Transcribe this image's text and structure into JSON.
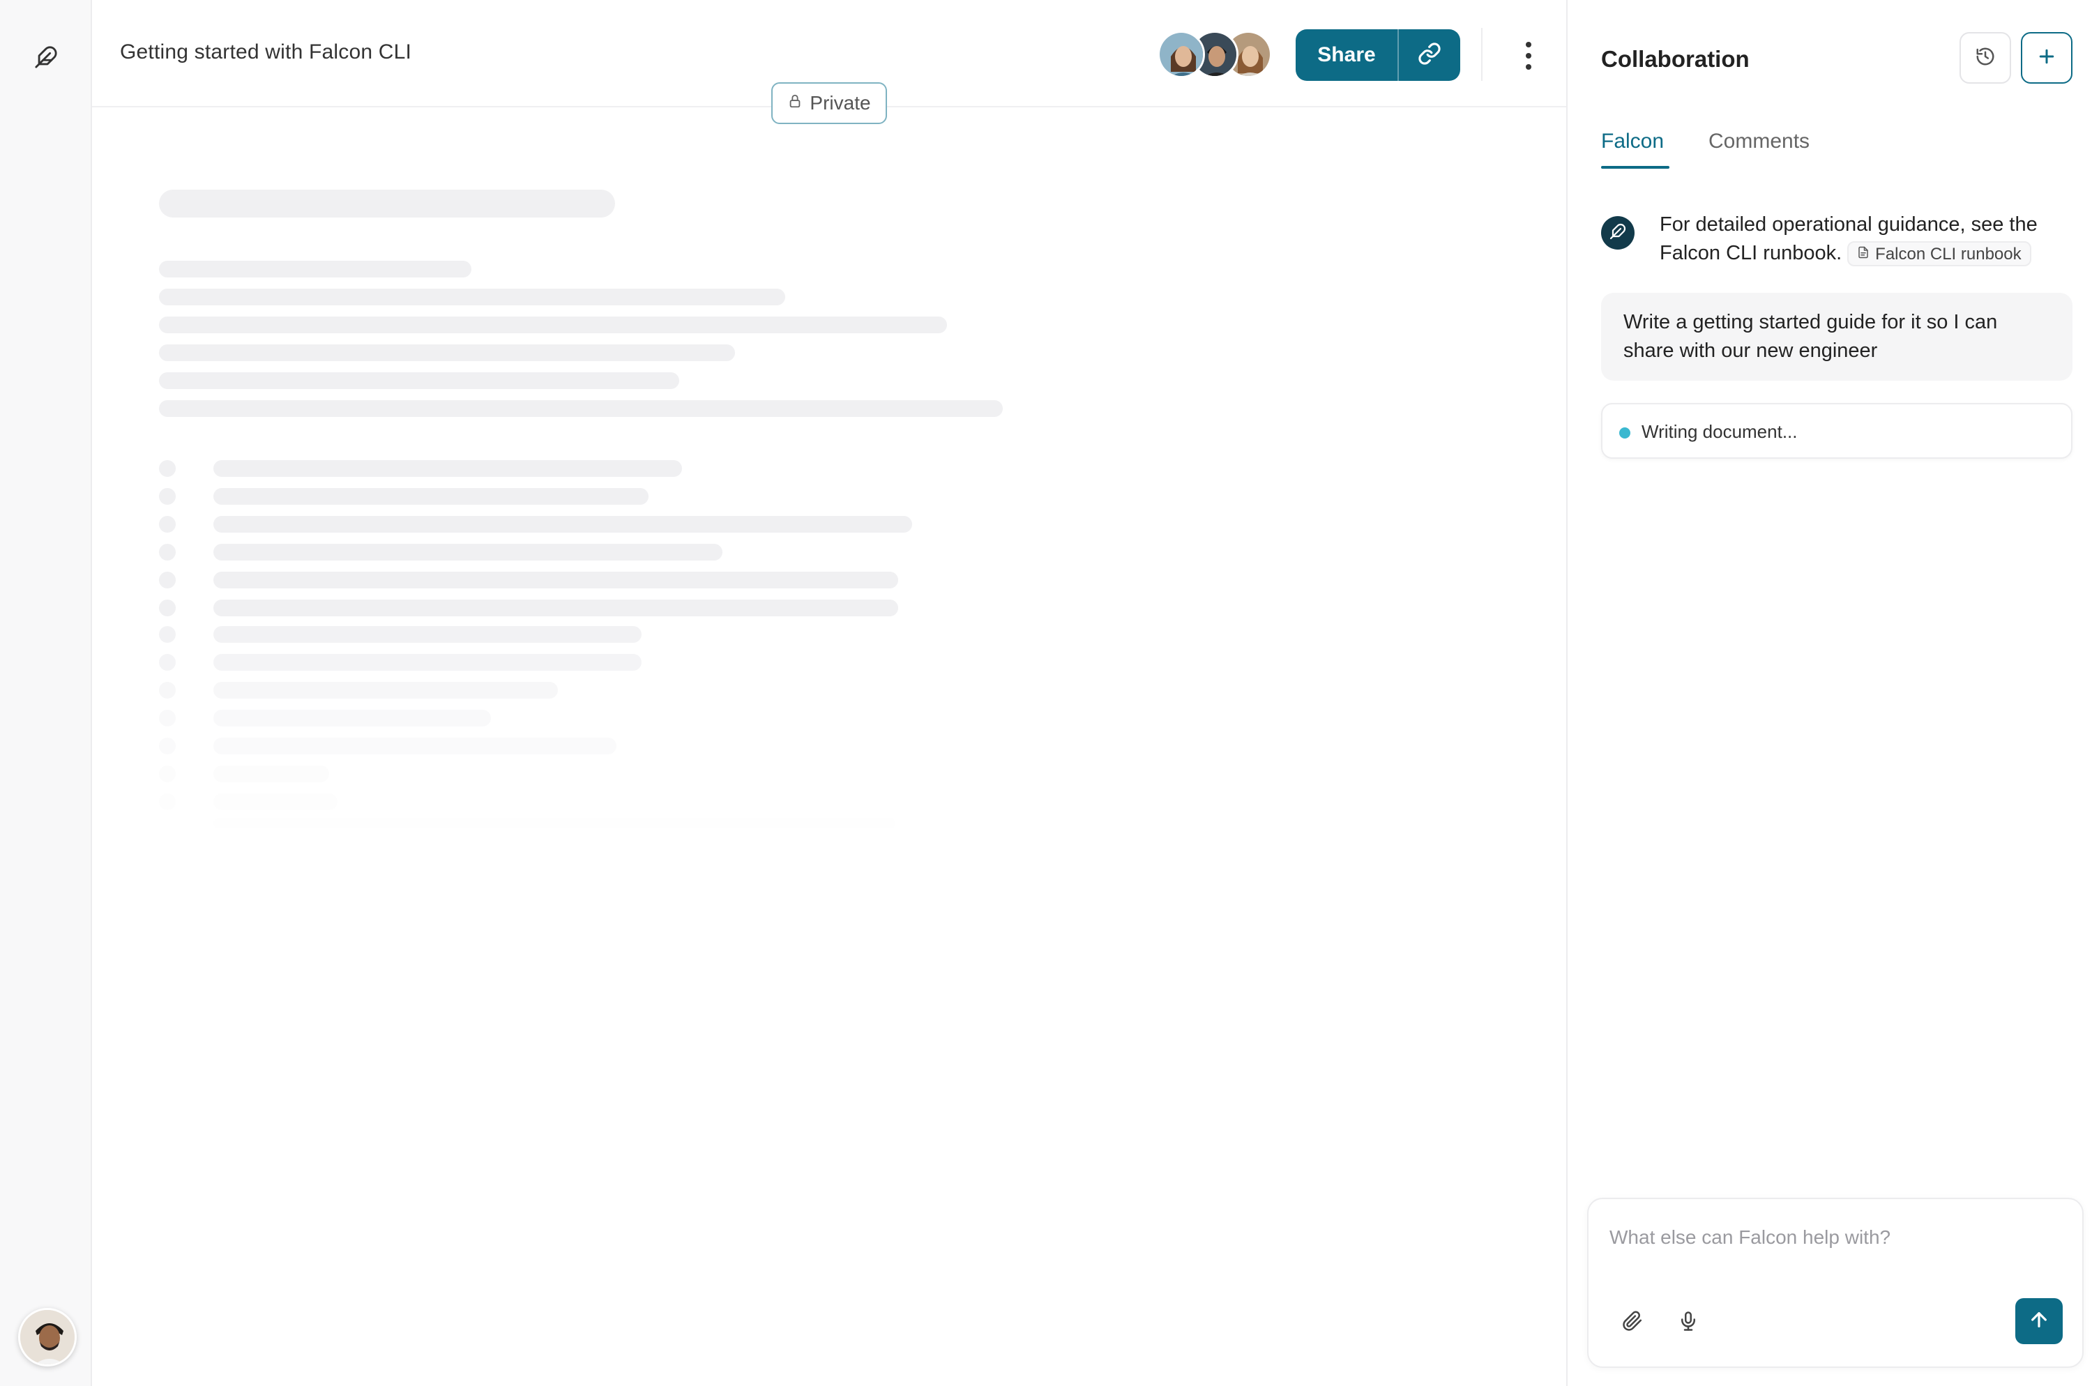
{
  "document": {
    "title": "Getting started with Falcon CLI",
    "visibility_label": "Private"
  },
  "header": {
    "share_label": "Share",
    "collaborators": [
      "collaborator-1",
      "collaborator-2",
      "collaborator-3"
    ]
  },
  "panel": {
    "title": "Collaboration",
    "tabs": [
      {
        "label": "Falcon",
        "active": true
      },
      {
        "label": "Comments",
        "active": false
      }
    ],
    "messages": {
      "assistant": {
        "text": "For detailed operational guidance, see the Falcon CLI runbook.",
        "reference_label": "Falcon CLI runbook"
      },
      "user": {
        "text": "Write a getting started guide for it so I can share with our new engineer"
      }
    },
    "status": {
      "text": "Writing document..."
    },
    "composer": {
      "placeholder": "What else can Falcon help with?"
    }
  },
  "colors": {
    "accent": "#0d6b86",
    "status_dot": "#3ab8d0",
    "skeleton": "#f0f0f2"
  },
  "icons": {
    "app_logo": "feather-icon",
    "history": "history-icon",
    "new": "plus-icon",
    "link": "link-icon",
    "more": "more-vertical-icon",
    "lock": "lock-icon",
    "attach": "paperclip-icon",
    "mic": "microphone-icon",
    "send": "arrow-up-icon",
    "document": "document-icon"
  }
}
